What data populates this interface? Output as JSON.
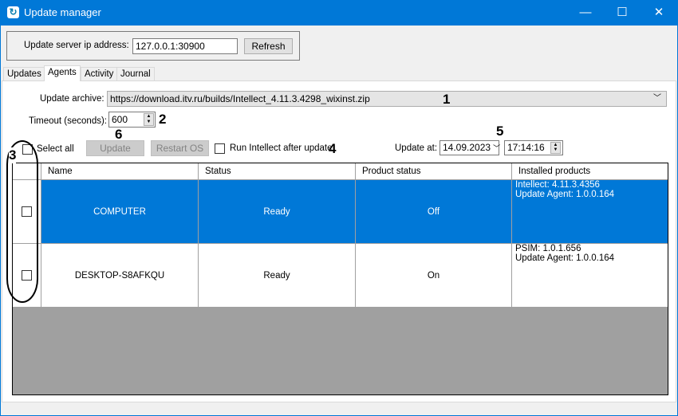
{
  "window": {
    "title": "Update manager",
    "minimize": "—",
    "maximize": "☐",
    "close": "✕"
  },
  "server": {
    "label": "Update server ip address:",
    "value": "127.0.0.1:30900",
    "refresh": "Refresh"
  },
  "tabs": [
    "Updates",
    "Agents",
    "Activity",
    "Journal"
  ],
  "agents": {
    "archive_label": "Update archive:",
    "archive_value": "https://download.itv.ru/builds/Intellect_4.11.3.4298_wixinst.zip",
    "timeout_label": "Timeout (seconds):",
    "timeout_value": "600",
    "select_all": "Select all",
    "update": "Update",
    "restart": "Restart OS",
    "run_after": "Run Intellect after update",
    "update_at": "Update at:",
    "date": "14.09.2023",
    "time": "17:14:16",
    "columns": [
      "Name",
      "Status",
      "Product status",
      "Installed products"
    ],
    "rows": [
      {
        "name": "COMPUTER",
        "status": "Ready",
        "product_status": "Off",
        "installed": [
          "Intellect: 4.11.3.4356",
          "Update Agent: 1.0.0.164"
        ]
      },
      {
        "name": "DESKTOP-S8AFKQU",
        "status": "Ready",
        "product_status": "On",
        "installed": [
          "PSIM: 1.0.1.656",
          "Update Agent: 1.0.0.164"
        ]
      }
    ]
  },
  "annotations": [
    "1",
    "2",
    "3",
    "4",
    "5",
    "6"
  ]
}
